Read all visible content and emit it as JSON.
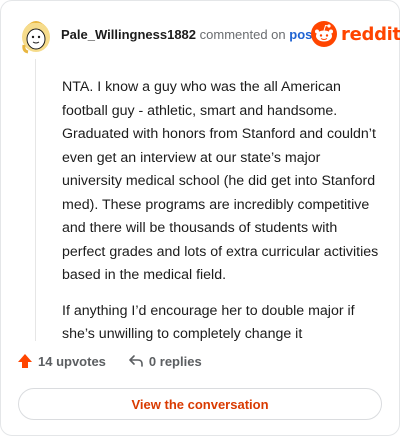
{
  "comment": {
    "username": "Pale_Willingness1882",
    "action_text": "commented on",
    "post_link": "post",
    "brand": "reddit",
    "paragraphs": [
      "NTA. I know a guy who was the all American football guy - athletic, smart and handsome. Graduated with honors from Stanford and couldn’t even get an interview at our state’s major university medical school (he did get into Stanford med). These programs are incredibly competitive and there will be thousands of students with perfect grades and lots of extra curricular activities based in the medical field.",
      "If anything I’d encourage her to double major if she’s unwilling to completely change it"
    ]
  },
  "footer": {
    "upvotes": "14 upvotes",
    "replies": "0 replies",
    "view_button": "View the conversation"
  },
  "colors": {
    "brand_orange": "#ff4500",
    "link_blue": "#1f63d2",
    "button_text": "#d93a00"
  },
  "icons": {
    "avatar": "snoo-avatar-icon",
    "brand": "reddit-logo-icon",
    "upvote": "upvote-arrow-icon",
    "reply": "reply-arrow-icon"
  }
}
